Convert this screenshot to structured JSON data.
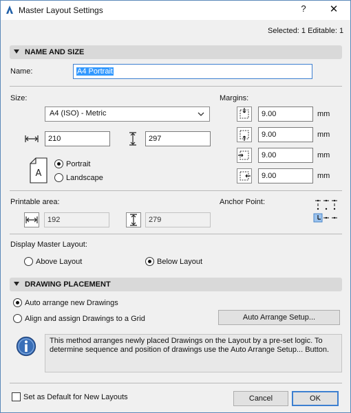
{
  "window": {
    "title": "Master Layout Settings",
    "help_label": "?",
    "close_label": "✕"
  },
  "selection_status": "Selected: 1 Editable: 1",
  "name_and_size": {
    "section_title": "NAME AND SIZE",
    "name_label": "Name:",
    "name_value": "A4 Portrait",
    "size_label": "Size:",
    "size_value": "A4 (ISO) - Metric",
    "width_value": "210",
    "height_value": "297",
    "orientation": {
      "portrait_label": "Portrait",
      "landscape_label": "Landscape",
      "selected": "portrait",
      "preview_letter": "A"
    },
    "margins_label": "Margins:",
    "margins": [
      {
        "side": "top",
        "value": "9.00",
        "unit": "mm"
      },
      {
        "side": "bottom",
        "value": "9.00",
        "unit": "mm"
      },
      {
        "side": "left",
        "value": "9.00",
        "unit": "mm"
      },
      {
        "side": "right",
        "value": "9.00",
        "unit": "mm"
      }
    ],
    "printable_area_label": "Printable area:",
    "printable_width": "192",
    "printable_height": "279",
    "anchor_point_label": "Anchor Point:",
    "anchor_selected": "bottom-left",
    "display_master_label": "Display Master Layout:",
    "display_above_label": "Above Layout",
    "display_below_label": "Below Layout",
    "display_selected": "below"
  },
  "drawing_placement": {
    "section_title": "DRAWING PLACEMENT",
    "auto_arrange_label": "Auto arrange new Drawings",
    "align_grid_label": "Align and assign Drawings to a Grid",
    "selected": "auto",
    "setup_button": "Auto Arrange Setup...",
    "info_text": "This method arranges newly placed Drawings on the Layout by a pre-set logic. To determine sequence and position of drawings use the Auto Arrange Setup... Button."
  },
  "footer": {
    "default_checkbox_label": "Set as Default for New Layouts",
    "default_checked": false,
    "cancel_label": "Cancel",
    "ok_label": "OK"
  }
}
